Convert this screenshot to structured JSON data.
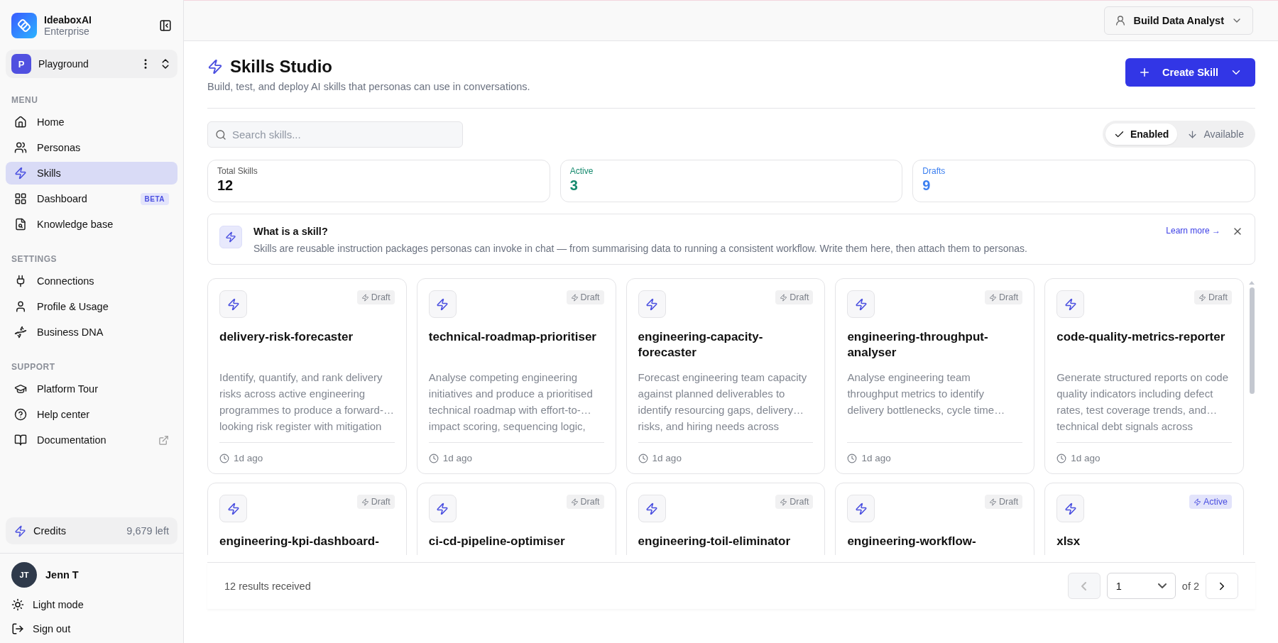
{
  "brand": {
    "name": "IdeaboxAI",
    "subtitle": "Enterprise"
  },
  "workspace": {
    "initial": "P",
    "name": "Playground"
  },
  "sidebar": [
    {
      "heading": "MENU",
      "items": [
        {
          "label": "Home",
          "selected": false
        },
        {
          "label": "Personas",
          "selected": false
        },
        {
          "label": "Skills",
          "selected": true
        },
        {
          "label": "Dashboard",
          "selected": false,
          "badge": "BETA"
        },
        {
          "label": "Knowledge base",
          "selected": false
        }
      ]
    },
    {
      "heading": "SETTINGS",
      "items": [
        {
          "label": "Connections",
          "selected": false
        },
        {
          "label": "Profile & Usage",
          "selected": false
        },
        {
          "label": "Business DNA",
          "selected": false
        }
      ]
    },
    {
      "heading": "SUPPORT",
      "items": [
        {
          "label": "Platform Tour",
          "selected": false
        },
        {
          "label": "Help center",
          "selected": false
        },
        {
          "label": "Documentation",
          "selected": false,
          "external": true
        }
      ]
    }
  ],
  "credits": {
    "label": "Credits",
    "value": "9,679 left"
  },
  "user": {
    "initials": "JT",
    "name": "Jenn T"
  },
  "account_links": [
    {
      "label": "Light mode"
    },
    {
      "label": "Sign out"
    }
  ],
  "persona_selector": {
    "label": "Build Data Analyst"
  },
  "page": {
    "title": "Skills Studio",
    "subtitle": "Build, test, and deploy AI skills that personas can use in conversations."
  },
  "create_button": {
    "label": "Create Skill"
  },
  "search": {
    "placeholder": "Search skills..."
  },
  "view_toggle": [
    {
      "label": "Enabled",
      "selected": true
    },
    {
      "label": "Available",
      "selected": false
    }
  ],
  "stats": [
    {
      "label": "Total Skills",
      "value": "12",
      "color": "#111111"
    },
    {
      "label": "Active",
      "value": "3",
      "color": "#168a6e"
    },
    {
      "label": "Drafts",
      "value": "9",
      "color": "#3b7ff0"
    }
  ],
  "info": {
    "title": "What is a skill?",
    "text": "Skills are reusable instruction packages personas can invoke in chat — from summarising data to running a consistent workflow. Write them here, then attach them to personas.",
    "link": "Learn more →"
  },
  "skills": [
    {
      "name": "delivery-risk-forecaster",
      "status": "Draft",
      "kind": "draft",
      "description": "Identify, quantify, and rank delivery risks across active engineering programmes to produce a forward-… looking risk register with mitigation",
      "age": "1d ago"
    },
    {
      "name": "technical-roadmap-prioritiser",
      "status": "Draft",
      "kind": "draft",
      "description": "Analyse competing engineering initiatives and produce a prioritised technical roadmap with effort-to-… impact scoring, sequencing logic,",
      "age": "1d ago"
    },
    {
      "name": "engineering-capacity-forecaster",
      "status": "Draft",
      "kind": "draft",
      "description": "Forecast engineering team capacity against planned deliverables to identify resourcing gaps, delivery… risks, and hiring needs across",
      "age": "1d ago"
    },
    {
      "name": "engineering-throughput-analyser",
      "status": "Draft",
      "kind": "draft",
      "description": "Analyse engineering team throughput metrics to identify delivery bottlenecks, cycle time…",
      "age": "1d ago"
    },
    {
      "name": "code-quality-metrics-reporter",
      "status": "Draft",
      "kind": "draft",
      "description": "Generate structured reports on code quality indicators including defect rates, test coverage trends, and… technical debt signals across",
      "age": "1d ago"
    },
    {
      "name": "engineering-kpi-dashboard-",
      "status": "Draft",
      "kind": "draft"
    },
    {
      "name": "ci-cd-pipeline-optimiser",
      "status": "Draft",
      "kind": "draft"
    },
    {
      "name": "engineering-toil-eliminator",
      "status": "Draft",
      "kind": "draft"
    },
    {
      "name": "engineering-workflow-",
      "status": "Draft",
      "kind": "draft"
    },
    {
      "name": "xlsx",
      "status": "Active",
      "kind": "active"
    }
  ],
  "footer": {
    "results": "12 results received",
    "page": "1",
    "of": "of 2",
    "prev_disabled": true
  }
}
